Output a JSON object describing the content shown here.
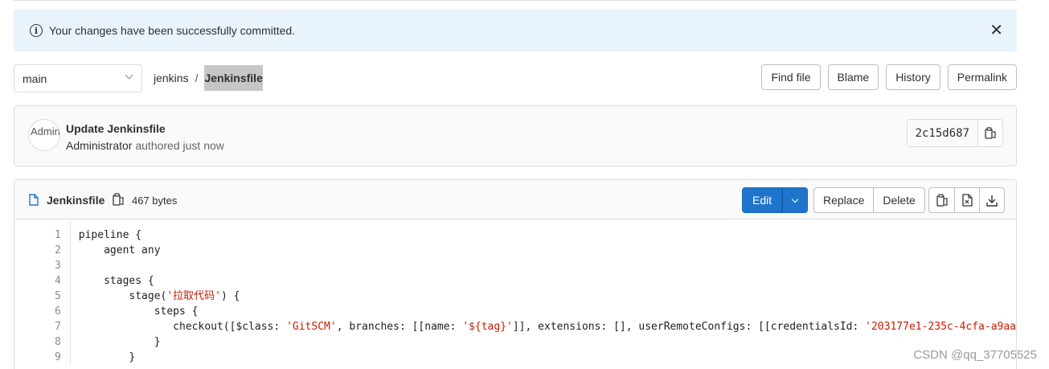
{
  "alert": {
    "message": "Your changes have been successfully committed.",
    "info_icon": "info-icon",
    "close_icon": "close-icon"
  },
  "branch": {
    "selected": "main"
  },
  "breadcrumb": {
    "repo": "jenkins",
    "separator": "/",
    "file": "Jenkinsfile"
  },
  "file_actions": [
    "Find file",
    "Blame",
    "History",
    "Permalink"
  ],
  "commit": {
    "avatar_alt": "Admin",
    "title": "Update Jenkinsfile",
    "author": "Administrator",
    "authored": "authored just now",
    "sha": "2c15d687"
  },
  "file": {
    "name": "Jenkinsfile",
    "size": "467 bytes",
    "edit_label": "Edit",
    "replace_label": "Replace",
    "delete_label": "Delete"
  },
  "code": {
    "line_numbers": [
      "1",
      "2",
      "3",
      "4",
      "5",
      "6",
      "7",
      "8",
      "9"
    ],
    "lines": [
      "pipeline {",
      "    agent any",
      "",
      "    stages {",
      "        stage('拉取代码') {",
      "            steps {",
      "               checkout([$class: 'GitSCM', branches: [[name: '${tag}']], extensions: [], userRemoteConfigs: [[credentialsId: '203177e1-235c-4cfa-a9aa",
      "            }",
      "        }"
    ]
  },
  "watermark": "CSDN @qq_37705525",
  "colors": {
    "primary": "#1f75cb",
    "alert_bg": "#e9f3fc",
    "string": "#c91c00"
  }
}
